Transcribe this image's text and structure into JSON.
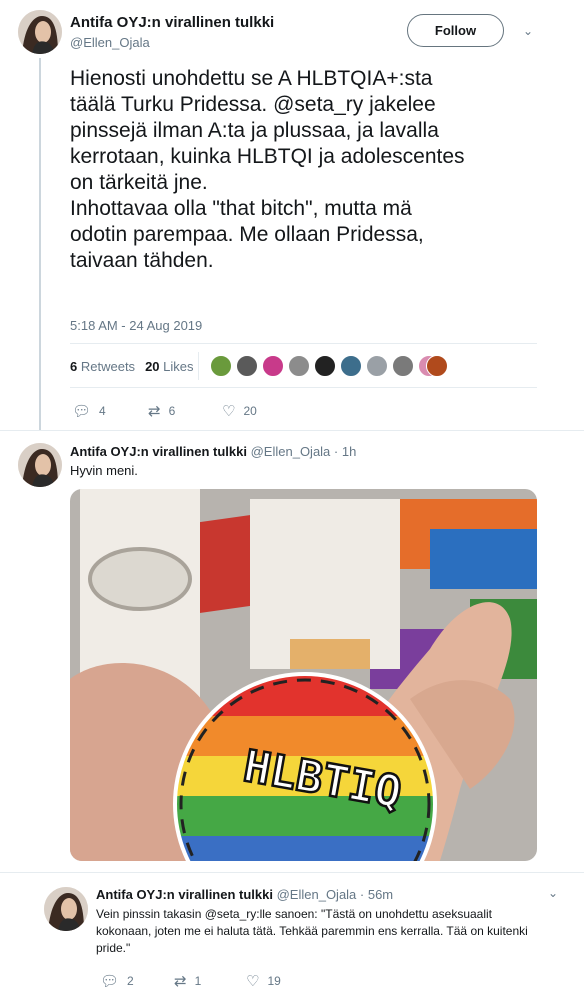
{
  "tweet": {
    "display_name": "Antifa OYJ:n virallinen tulkki",
    "handle": "@Ellen_Ojala",
    "follow_label": "Follow",
    "text": "Hienosti unohdettu se A HLBTQIA+:sta\ntäälä Turku Pridessa. @seta_ry jakelee\npinssejä ilman A:ta ja plussaa, ja lavalla\nkerrotaan, kuinka HLBTQI ja adolescentes\non tärkeitä jne.\nInhottavaa olla \"that bitch\", mutta mä\nodotin parempaa. Me ollaan Pridessa,\ntaivaan tähden.",
    "timestamp": "5:18 AM - 24 Aug 2019",
    "retweets_count": "6",
    "retweets_label": "Retweets",
    "likes_count": "20",
    "likes_label": "Likes",
    "actions": {
      "replies": "4",
      "retweets": "6",
      "likes": "20"
    }
  },
  "reply1": {
    "display_name": "Antifa OYJ:n virallinen tulkki",
    "handle_time": "@Ellen_Ojala · 1h",
    "text": "Hyvin meni.",
    "pin_text": "HLBTIQ"
  },
  "reply2": {
    "display_name": "Antifa OYJ:n virallinen tulkki",
    "handle_time": "@Ellen_Ojala · 56m",
    "text": "Vein pinssin takasin @seta_ry:lle sanoen: \"Tästä on unohdettu aseksuaalit\nkokonaan, joten me ei haluta tätä. Tehkää paremmin ens kerralla. Tää on kuitenki\npride.\"",
    "actions": {
      "replies": "2",
      "retweets": "1",
      "likes": "19"
    }
  },
  "colors": {
    "text": "#14171a",
    "secondary": "#657786",
    "divider": "#e6ecf0",
    "thread_line": "#ccd6dd"
  },
  "icons": [
    "chevron-down-icon",
    "reply-icon",
    "retweet-icon",
    "heart-icon"
  ]
}
